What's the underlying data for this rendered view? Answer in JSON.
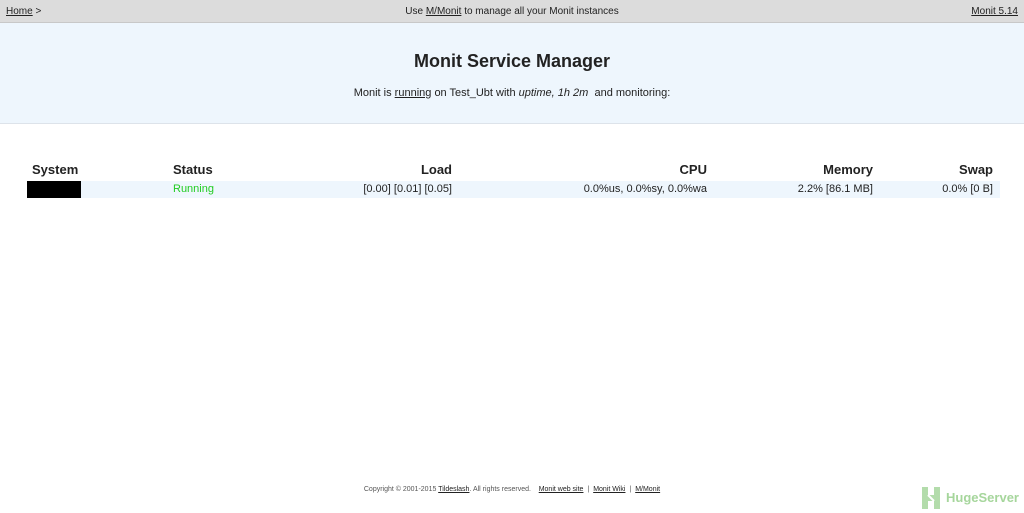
{
  "nav": {
    "home": "Home",
    "home_sep": ">",
    "center_prefix": "Use",
    "center_link": "M/Monit",
    "center_suffix": "to manage all your Monit instances",
    "version": "Monit 5.14"
  },
  "header": {
    "title": "Monit Service Manager",
    "status_prefix": "Monit is",
    "status_link": "running",
    "status_mid": "on Test_Ubt with",
    "uptime": "uptime, 1h 2m",
    "status_suffix": "and monitoring:"
  },
  "table": {
    "columns": [
      "System",
      "Status",
      "Load",
      "CPU",
      "Memory",
      "Swap"
    ],
    "rows": [
      {
        "system": "",
        "status": "Running",
        "load": "[0.00] [0.01] [0.05]",
        "cpu": "0.0%us, 0.0%sy, 0.0%wa",
        "memory": "2.2% [86.1 MB]",
        "swap": "0.0% [0 B]"
      }
    ]
  },
  "footer": {
    "copyright": "Copyright © 2001-2015",
    "company": "Tildeslash",
    "rights": ". All rights reserved.",
    "website": "Monit web site",
    "sep": "|",
    "wiki": "Monit Wiki",
    "mmonit": "M/Monit"
  },
  "watermark": {
    "text": "HugeServer",
    "icon": "hugeserver-logo-icon"
  },
  "colors": {
    "running": "#22cc22",
    "header_bg": "#eef6fd",
    "nav_bg": "#dcdcdc"
  }
}
